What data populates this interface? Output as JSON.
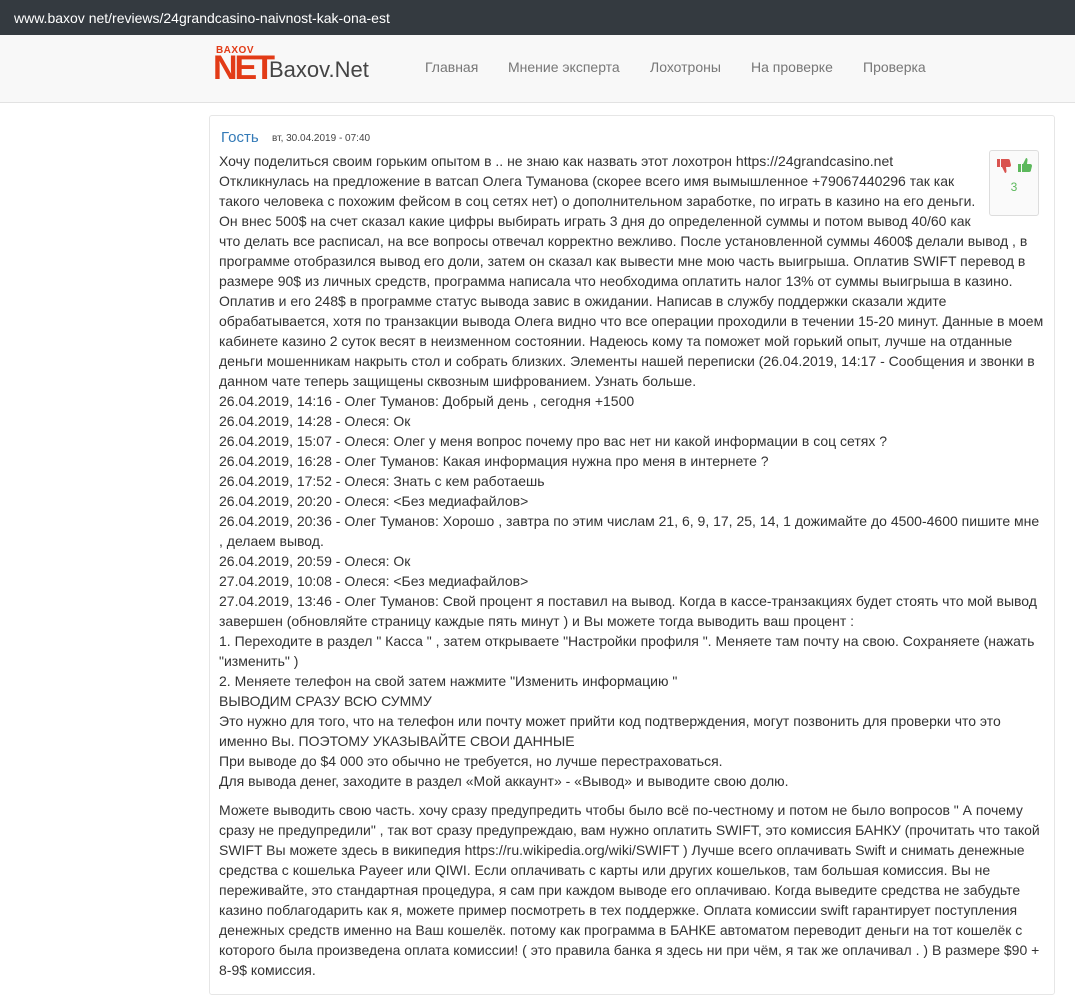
{
  "url": "www.baxov net/reviews/24grandcasino-naivnost-kak-ona-est",
  "site": {
    "logo_small": "BAXOV",
    "logo_big": "NET",
    "brand": "Baxov.Net"
  },
  "nav": [
    "Главная",
    "Мнение эксперта",
    "Лохотроны",
    "На проверке",
    "Проверка"
  ],
  "comment": {
    "author": "Гость",
    "date": "вт, 30.04.2019 - 07:40",
    "score": "3",
    "lines": [
      "Хочу поделиться своим горьким опытом в .. не знаю как назвать этот лохотрон https://24grandcasino.net",
      "Откликнулась на предложение в ватсап Олега Туманова (скорее всего имя вымышленное +79067440296 так как",
      "такого человека с похожим фейсом в соц сетях нет) о дополнительном заработке, по играть в казино на его деньги.",
      "Он внес 500$ на счет сказал какие цифры выбирать играть 3 дня до определенной суммы и потом вывод 40/60 как",
      "что делать все расписал, на все вопросы отвечал корректно вежливо. После установленной суммы 4600$ делали вывод , в",
      "программе отобразился вывод его доли, затем он сказал как вывести мне мою часть выигрыша. Оплатив SWIFT перевод в",
      "размере 90$ из личных средств, программа написала что необходима оплатить налог 13% от суммы выигрыша в казино.",
      "Оплатив и его 248$ в программе статус вывода завис в ожидании. Написав в службу поддержки сказали ждите",
      "обрабатывается, хотя по транзакции вывода Олега видно что все операции проходили в течении 15-20 минут. Данные в моем",
      "кабинете казино 2 суток весят в неизменном состоянии. Надеюсь кому та поможет мой горький опыт, лучше на отданные",
      "деньги мошенникам накрыть стол и собрать близких. Элементы нашей переписки (26.04.2019, 14:17 - Сообщения и звонки в",
      "данном чате теперь защищены сквозным шифрованием. Узнать больше.",
      "26.04.2019, 14:16 - Олег Туманов: Добрый день , сегодня +1500",
      "26.04.2019, 14:28 - Олеся: Ок",
      "26.04.2019, 15:07 - Олеся: Олег у меня вопрос почему про вас нет ни какой информации в соц сетях ?",
      "26.04.2019, 16:28 - Олег Туманов: Какая информация нужна про меня в интернете ?",
      "26.04.2019, 17:52 - Олеся: Знать с кем работаешь",
      "26.04.2019, 20:20 - Олеся: <Без медиафайлов>",
      "26.04.2019, 20:36 - Олег Туманов: Хорошо , завтра по этим числам 21, 6, 9, 17, 25, 14, 1 дожимайте до 4500-4600 пишите мне",
      ", делаем вывод.",
      "26.04.2019, 20:59 - Олеся: Ок",
      "27.04.2019, 10:08 - Олеся: <Без медиафайлов>",
      "27.04.2019, 13:46 - Олег Туманов: Свой процент я поставил на вывод. Когда в кассе-транзакциях будет стоять что мой вывод",
      "завершен (обновляйте страницу каждые пять минут ) и Вы можете тогда выводить ваш процент :",
      "1. Переходите в раздел \" Касса \" , затем открываете \"Настройки профиля \". Меняете там почту на свою. Сохраняете (нажать",
      "\"изменить\" )",
      "2. Меняете телефон на свой затем нажмите \"Изменить информацию \"",
      "ВЫВОДИМ СРАЗУ ВСЮ СУММУ",
      "Это нужно для того, что на телефон или почту может прийти код подтверждения, могут позвонить для проверки что это",
      "именно Вы. ПОЭТОМУ УКАЗЫВАЙТЕ СВОИ ДАННЫЕ",
      "При выводе до $4 000 это обычно не требуется, но лучше перестраховаться.",
      "Для вывода денег, заходите в раздел «Мой аккаунт» - «Вывод» и выводите свою долю."
    ],
    "lines2": [
      "Можете выводить свою часть. хочу сразу предупредить чтобы было всё по-честному и потом не было вопросов \" А почему",
      "сразу не предупредили\" , так вот сразу предупреждаю, вам нужно оплатить SWIFT, это комиссия БАНКУ (прочитать что такой",
      "SWIFT Вы можете здесь в википедия https://ru.wikipedia.org/wiki/SWIFT ) Лучше всего оплачивать Swift и снимать денежные",
      "средства с кошелька Payeer или QIWI. Если оплачивать с карты или других кошельков, там большая комиссия. Вы не",
      "переживайте, это стандартная процедура, я сам при каждом выводе его оплачиваю. Когда выведите средства не забудьте",
      "казино поблагодарить как я, можете пример посмотреть в тех поддержке. Оплата комиссии swift гарантирует поступления",
      "денежных средств именно на Ваш кошелёк. потому как программа в БАНКЕ автоматом переводит деньги на тот кошелёк с",
      "которого была произведена оплата комиссии! ( это правила банка я здесь ни при чём, я так же оплачивал . ) В размере $90 +",
      "8-9$ комиссия."
    ]
  }
}
